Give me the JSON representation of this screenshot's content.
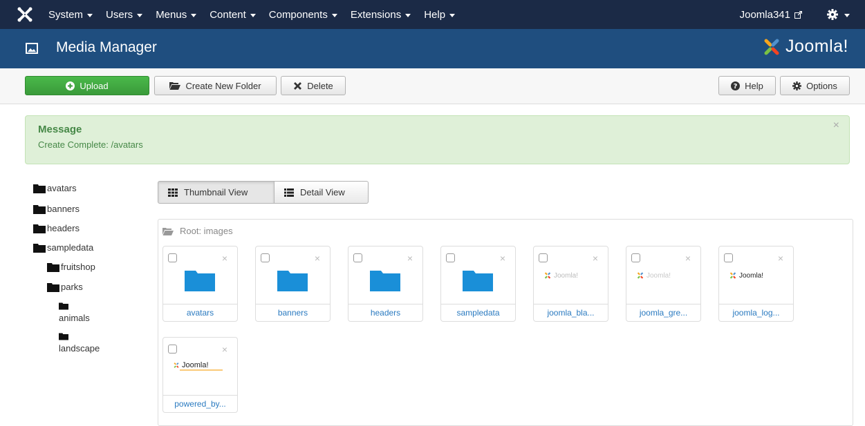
{
  "navbar": {
    "menu": [
      "System",
      "Users",
      "Menus",
      "Content",
      "Components",
      "Extensions",
      "Help"
    ],
    "site_link": "Joomla341"
  },
  "header": {
    "title": "Media Manager",
    "brand": "Joomla!"
  },
  "toolbar": {
    "upload": "Upload",
    "create_folder": "Create New Folder",
    "delete": "Delete",
    "help": "Help",
    "options": "Options"
  },
  "message": {
    "heading": "Message",
    "text": "Create Complete: /avatars",
    "close": "×"
  },
  "tree": {
    "items": [
      "avatars",
      "banners",
      "headers",
      "sampledata",
      "fruitshop",
      "parks",
      "animals",
      "landscape"
    ]
  },
  "views": {
    "thumbnail": "Thumbnail View",
    "detail": "Detail View"
  },
  "breadcrumb": "Root: images",
  "thumbnails": [
    {
      "label": "avatars",
      "type": "folder"
    },
    {
      "label": "banners",
      "type": "folder"
    },
    {
      "label": "headers",
      "type": "folder"
    },
    {
      "label": "sampledata",
      "type": "folder"
    },
    {
      "label": "joomla_bla...",
      "type": "image",
      "image_text": "Joomla!"
    },
    {
      "label": "joomla_gre...",
      "type": "image",
      "image_text": "Joomla!"
    },
    {
      "label": "joomla_log...",
      "type": "image",
      "image_text": "Joomla!"
    },
    {
      "label": "powered_by...",
      "type": "image",
      "image_text": "Joomla!"
    }
  ],
  "colors": {
    "navbar": "#1b2a46",
    "header": "#1f4e7f",
    "upload_button": "#46a546",
    "folder_icon": "#1a8fd8",
    "link": "#2a7ac0",
    "alert_bg": "#dff0d8"
  }
}
